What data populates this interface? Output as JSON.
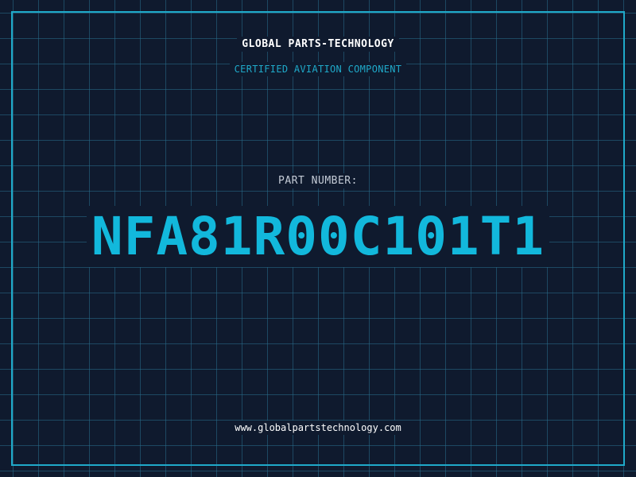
{
  "header": {
    "company": "GLOBAL PARTS-TECHNOLOGY",
    "subtitle": "CERTIFIED AVIATION COMPONENT"
  },
  "part": {
    "label": "PART NUMBER:",
    "number": "NFA81R00C101T1"
  },
  "footer": {
    "url": "www.globalpartstechnology.com"
  },
  "colors": {
    "background": "#0f1a2e",
    "accent": "#12b8dc",
    "grid": "#286e8c",
    "text": "#ffffff"
  }
}
